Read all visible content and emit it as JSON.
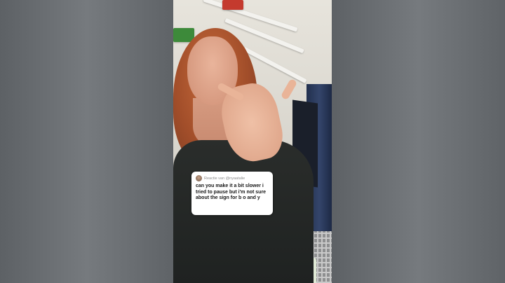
{
  "comment_card": {
    "reply_label": "Reactie van @nyaatalie",
    "text": "can you make it a bit slower i tried to pause but i'm not sure about the sign for b o and y"
  },
  "icons": {
    "avatar": "user-avatar"
  }
}
